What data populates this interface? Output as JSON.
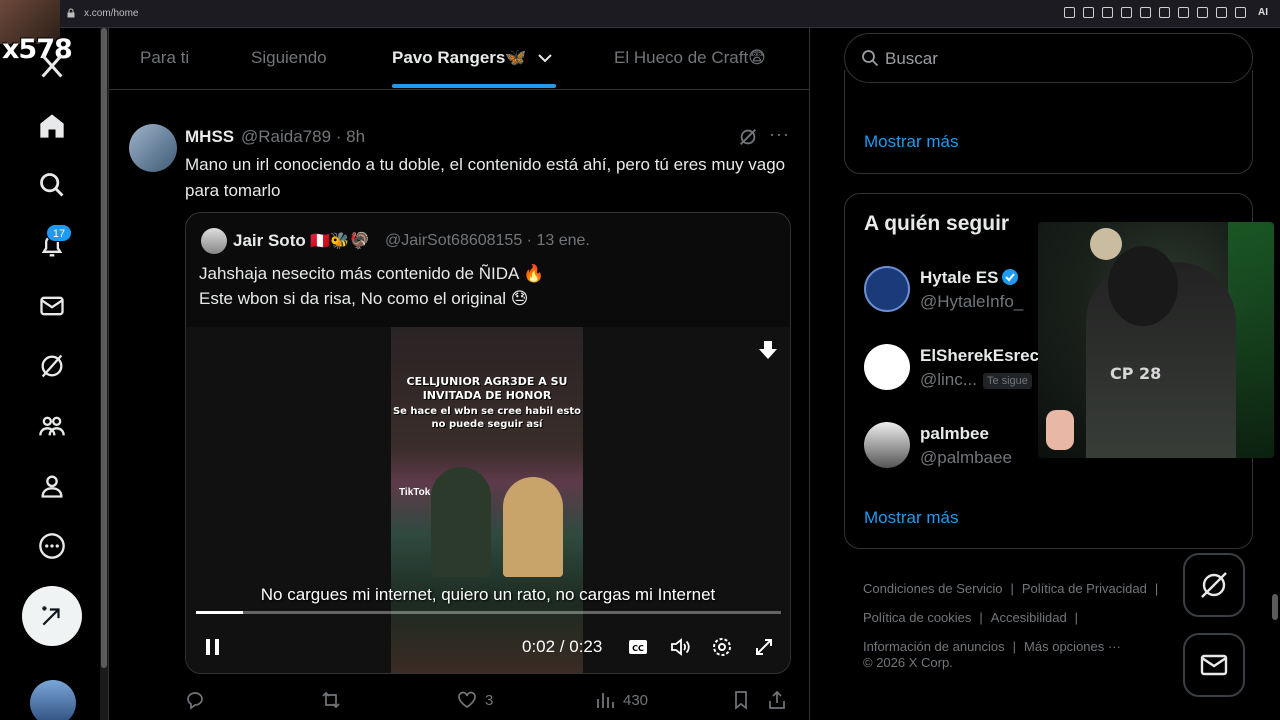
{
  "browser": {
    "url": "x.com/home",
    "ai_label": "AI"
  },
  "overlay": {
    "streamer_tag": "x578"
  },
  "nav": {
    "notifications_badge": "17",
    "items": [
      "x-logo",
      "home-icon",
      "search-icon",
      "bell-icon",
      "mail-icon",
      "grok-icon",
      "communities-icon",
      "profile-icon",
      "more-icon"
    ]
  },
  "tabs": [
    {
      "label": "Para ti"
    },
    {
      "label": "Siguiendo"
    },
    {
      "label": "Pavo Rangers🦋"
    },
    {
      "label": "El Hueco de Craft😨"
    }
  ],
  "tweet": {
    "name": "MHSS",
    "handle_time": "@Raida789 · 8h",
    "text": "Mano un irl conociendo a tu doble, el contenido está ahí, pero tú eres muy vago para tomarlo",
    "quote": {
      "name": "Jair Soto",
      "flags": "🇵🇪🐝🦃",
      "handle_time": "@JairSot68608155 · 13 ene.",
      "line1": "Jahshaja nesecito más contenido de ÑIDA 🔥",
      "line2": "Este wbon si da risa, No como el original 😓",
      "video": {
        "caption_title": "CELLJUNIOR AGR3DE A SU INVITADA DE HONOR",
        "caption_sub": "Se hace el wbn se cree habil esto no puede seguir así",
        "tiktok": "TikTok",
        "subtitle": "No cargues mi internet, quiero un rato, no cargas mi Internet",
        "time": "0:02 / 0:23",
        "progress": 0.08
      }
    },
    "actions": {
      "replies": "",
      "retweets": "",
      "likes": "3",
      "views": "430"
    }
  },
  "search": {
    "placeholder": "Buscar"
  },
  "trends_card": {
    "show_more": "Mostrar más"
  },
  "who_to_follow": {
    "title": "A quién seguir",
    "accounts": [
      {
        "name": "Hytale ES",
        "handle": "@HytaleInfo_",
        "tag": ""
      },
      {
        "name": "ElSherekEsrec",
        "handle": "@linc...",
        "tag": "Te sigue"
      },
      {
        "name": "palmbee",
        "handle": "@palmbaee",
        "tag": ""
      }
    ],
    "show_more": "Mostrar más"
  },
  "footer": {
    "links": [
      "Condiciones de Servicio",
      "Política de Privacidad",
      "Política de cookies",
      "Accesibilidad",
      "Información de anuncios",
      "Más opciones ···"
    ],
    "copyright": "© 2026 X Corp."
  },
  "webcam": {
    "shirt_text": "CP 28"
  },
  "colors": {
    "accent": "#1d9bf0",
    "background": "#000000",
    "text": "#e7e9ea",
    "muted": "#71767b",
    "border": "#2f3336"
  }
}
